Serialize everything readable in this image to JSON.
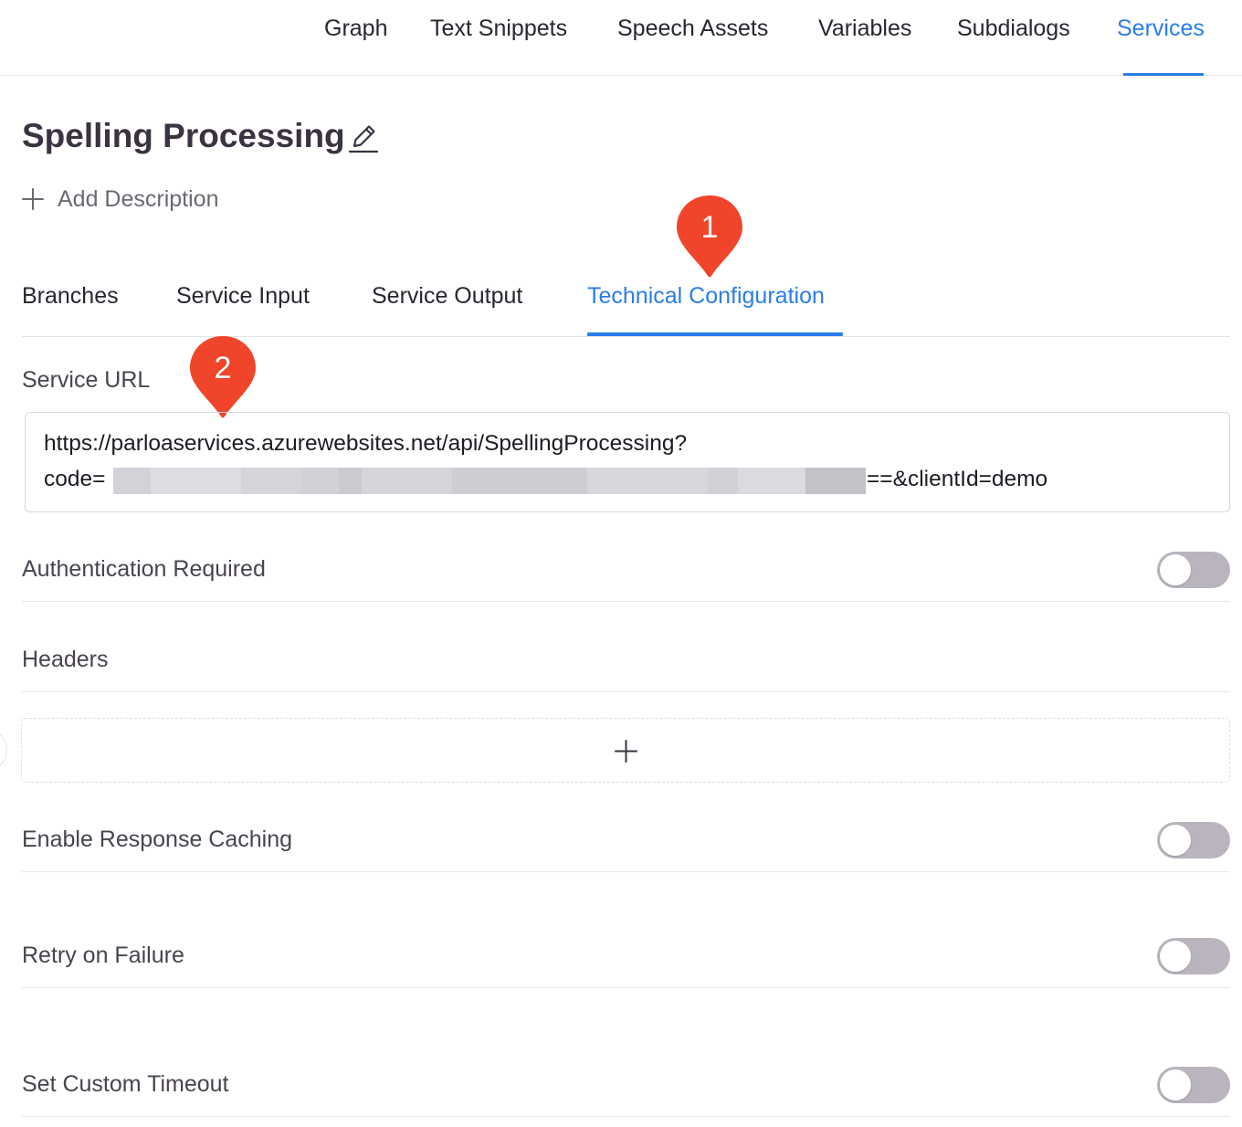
{
  "topnav": {
    "items": [
      {
        "label": "Graph"
      },
      {
        "label": "Text Snippets"
      },
      {
        "label": "Speech Assets"
      },
      {
        "label": "Variables"
      },
      {
        "label": "Subdialogs"
      },
      {
        "label": "Services"
      }
    ],
    "active": "Services"
  },
  "service": {
    "title": "Spelling Processing",
    "add_description": "Add Description"
  },
  "tabs": {
    "items": [
      {
        "label": "Branches"
      },
      {
        "label": "Service Input"
      },
      {
        "label": "Service Output"
      },
      {
        "label": "Technical Configuration"
      }
    ],
    "active": "Technical Configuration"
  },
  "markers": [
    "1",
    "2"
  ],
  "technical_configuration": {
    "service_url_label": "Service URL",
    "service_url_line1": "https://parloaservices.azurewebsites.net/api/SpellingProcessing?",
    "service_url_line2_prefix": "code=",
    "service_url_line2_suffix": "==&clientId=demo",
    "authentication_label": "Authentication Required",
    "authentication_enabled": false,
    "headers_label": "Headers",
    "caching_label": "Enable Response Caching",
    "caching_enabled": false,
    "retry_label": "Retry on Failure",
    "retry_enabled": false,
    "timeout_label": "Set Custom Timeout",
    "timeout_enabled": false
  },
  "colors": {
    "accent": "#2b7de9",
    "marker": "#f0452b",
    "toggle_off": "#b9b4bd",
    "title": "#3b3341"
  }
}
